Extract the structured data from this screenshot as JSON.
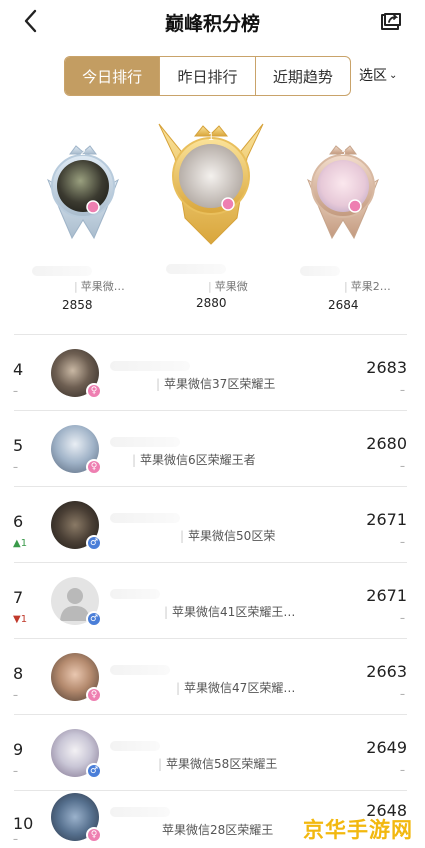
{
  "header": {
    "title": "巅峰积分榜"
  },
  "tabs": [
    {
      "label": "今日排行",
      "active": true
    },
    {
      "label": "昨日排行",
      "active": false
    },
    {
      "label": "近期趋势",
      "active": false
    }
  ],
  "region": {
    "label": "选区"
  },
  "podium": [
    {
      "rank": "2",
      "server": "苹果微…",
      "score": "2858"
    },
    {
      "rank": "1",
      "server": "苹果微",
      "score": "2880"
    },
    {
      "rank": "3",
      "server": "苹果2…",
      "score": "2684"
    }
  ],
  "rows": [
    {
      "rank": "4",
      "trend": "–",
      "server": "苹果微信37区荣耀王",
      "score": "2683",
      "score_change": "–"
    },
    {
      "rank": "5",
      "trend": "–",
      "server": "苹果微信6区荣耀王者",
      "score": "2680",
      "score_change": "–"
    },
    {
      "rank": "6",
      "trend": "▲1",
      "server": "苹果微信50区荣",
      "score": "2671",
      "score_change": "–"
    },
    {
      "rank": "7",
      "trend": "▼1",
      "server": "苹果微信41区荣耀王…",
      "score": "2671",
      "score_change": "–"
    },
    {
      "rank": "8",
      "trend": "–",
      "server": "苹果微信47区荣耀…",
      "score": "2663",
      "score_change": "–"
    },
    {
      "rank": "9",
      "trend": "–",
      "server": "苹果微信58区荣耀王",
      "score": "2649",
      "score_change": "–"
    },
    {
      "rank": "10",
      "trend": "–",
      "server": "苹果微信28区荣耀王",
      "score": "2648",
      "score_change": ""
    }
  ],
  "watermark": "京华手游网",
  "colors": {
    "accent": "#c39d62",
    "female": "#ee7fb1",
    "male": "#4a7ed8",
    "trend_up": "#3a9a4a",
    "trend_down": "#c0392b"
  }
}
